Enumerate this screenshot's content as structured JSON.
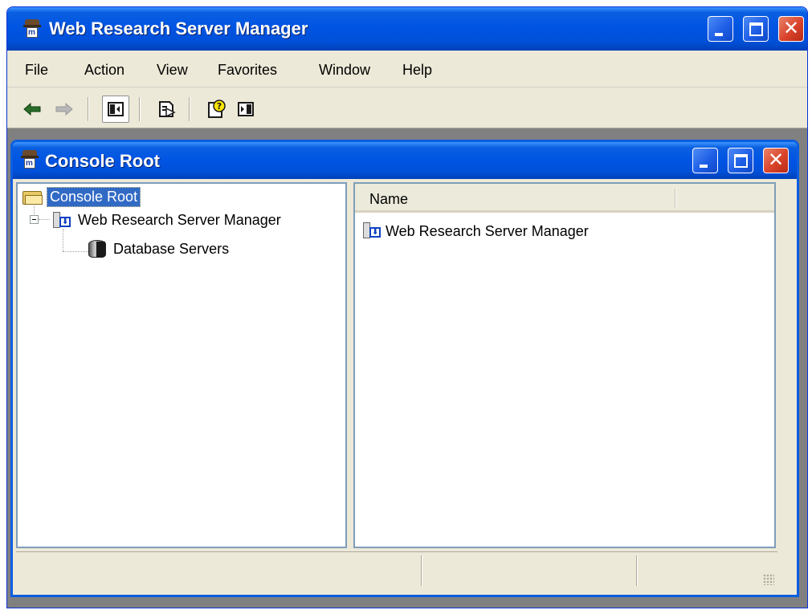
{
  "app": {
    "title": "Web Research Server Manager"
  },
  "menu": [
    {
      "label": "File"
    },
    {
      "label": "Action"
    },
    {
      "label": "View"
    },
    {
      "label": "Favorites"
    },
    {
      "label": "Window"
    },
    {
      "label": "Help"
    }
  ],
  "toolbar": {
    "back_icon": "arrow-left-icon",
    "forward_icon": "arrow-right-icon",
    "show_hide_tree_icon": "show-hide-console-tree-icon",
    "export_list_icon": "export-list-icon",
    "help_icon": "help-icon",
    "show_hide_action_pane_icon": "show-hide-action-pane-icon"
  },
  "child_window": {
    "title": "Console Root"
  },
  "tree": {
    "items": [
      {
        "label": "Console Root",
        "icon": "folder-icon",
        "selected": true
      },
      {
        "label": "Web Research Server Manager",
        "icon": "server-manager-icon",
        "expanded": true
      },
      {
        "label": "Database Servers",
        "icon": "database-icon"
      }
    ]
  },
  "list": {
    "columns": [
      {
        "label": "Name"
      }
    ],
    "rows": [
      {
        "name": "Web Research Server Manager",
        "icon": "server-manager-icon"
      }
    ]
  },
  "colors": {
    "titlebar": "#0054e3",
    "selection": "#316ac5",
    "window_bg": "#ece9d8",
    "close_button": "#d9432b"
  }
}
